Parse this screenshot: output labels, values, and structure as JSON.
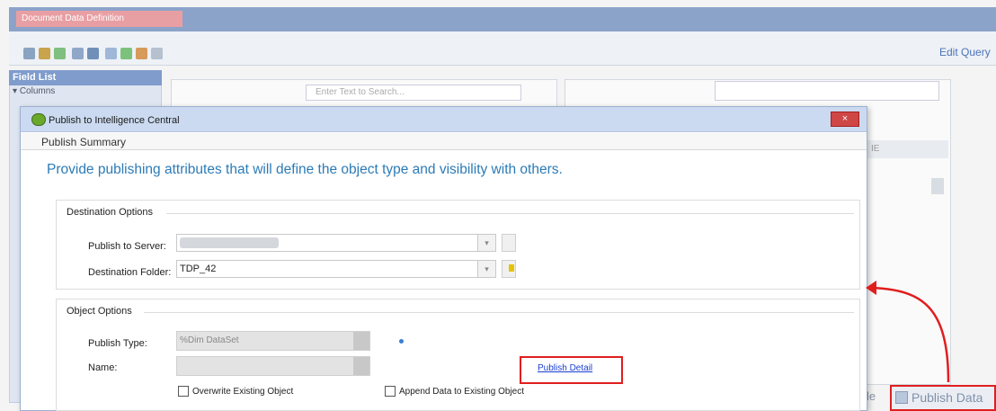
{
  "background": {
    "window_title": "Document Data Definition",
    "edit_query_label": "Edit Query",
    "field_list_title": "Field List",
    "columns_label": "Columns",
    "search_placeholder": "Enter Text to Search...",
    "grid_header": "IE",
    "publish_data_label": "Publish Data",
    "partial_label": "le",
    "toolbar_icons": [
      "grid-icon",
      "table-icon",
      "transfer-icon",
      "report-icon",
      "save-icon",
      "copy-icon",
      "export-icon",
      "database-icon",
      "refresh-icon"
    ]
  },
  "dialog": {
    "title": "Publish to Intelligence Central",
    "close_symbol": "×",
    "summary_tab": "Publish Summary",
    "heading": "Provide publishing attributes that will define the object type and visibility with others.",
    "destination": {
      "group_title": "Destination Options",
      "server_label": "Publish to Server:",
      "server_value": "",
      "folder_label": "Destination Folder:",
      "folder_value": "TDP_42"
    },
    "object": {
      "group_title": "Object Options",
      "type_label": "Publish Type:",
      "type_value": "%Dim DataSet",
      "name_label": "Name:",
      "name_value": "",
      "publish_detail_link": "Publish Detail",
      "overwrite_label": "Overwrite Existing Object",
      "overwrite_checked": false,
      "append_label": "Append Data to Existing Object",
      "append_checked": false
    }
  },
  "colors": {
    "heading": "#2c7bb6",
    "highlight": "#e01e1e",
    "link": "#1a3fd0"
  }
}
